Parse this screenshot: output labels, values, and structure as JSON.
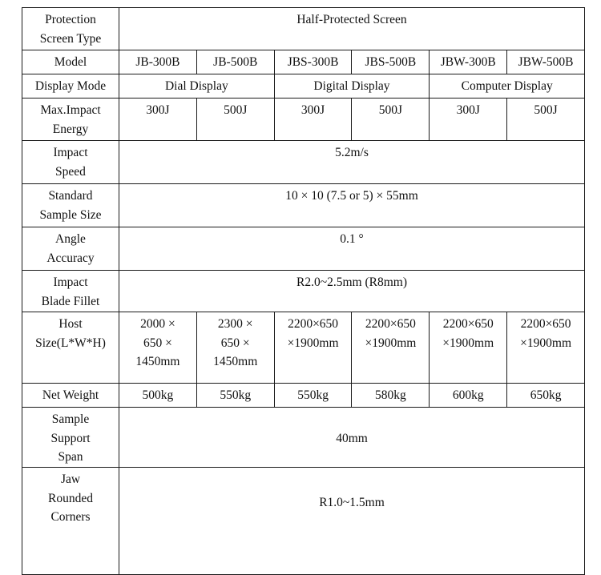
{
  "table": {
    "columns": [
      "JB-300B",
      "JB-500B",
      "JBS-300B",
      "JBS-500B",
      "JBW-300B",
      "JBW-500B"
    ],
    "rows": [
      {
        "label": "Protection\nScreen Type",
        "label_lines": [
          "Protection",
          "Screen Type"
        ],
        "span": true,
        "value": "Half-Protected Screen"
      },
      {
        "label": "Model",
        "label_lines": [
          "Model"
        ],
        "span": false,
        "values": [
          "JB-300B",
          "JB-500B",
          "JBS-300B",
          "JBS-500B",
          "JBW-300B",
          "JBW-500B"
        ]
      },
      {
        "label": "Display Mode",
        "label_lines": [
          "Display Mode"
        ],
        "span": false,
        "groups": [
          {
            "value": "Dial Display",
            "cols": 2
          },
          {
            "value": "Digital Display",
            "cols": 2
          },
          {
            "value": "Computer Display",
            "cols": 2
          }
        ]
      },
      {
        "label": "Max.Impact Energy",
        "label_lines": [
          "Max.Impact",
          "Energy"
        ],
        "span": false,
        "values": [
          "300J",
          "500J",
          "300J",
          "500J",
          "300J",
          "500J"
        ]
      },
      {
        "label": "Impact Speed",
        "label_lines": [
          "Impact",
          "Speed"
        ],
        "span": true,
        "value": "5.2m/s"
      },
      {
        "label": "Standard Sample Size",
        "label_lines": [
          "Standard",
          "Sample Size"
        ],
        "span": true,
        "value": "10 × 10 (7.5 or 5) × 55mm"
      },
      {
        "label": "Angle Accuracy",
        "label_lines": [
          "Angle",
          "Accuracy"
        ],
        "span": true,
        "value": "0.1 °"
      },
      {
        "label": "Impact Blade Fillet",
        "label_lines": [
          "Impact",
          "Blade Fillet"
        ],
        "span": true,
        "value": "R2.0~2.5mm (R8mm)"
      },
      {
        "label": "Host Size(L*W*H)",
        "label_lines": [
          "Host",
          "Size(L*W*H)"
        ],
        "span": false,
        "values_lines": [
          [
            "2000 ×",
            "650 ×",
            "1450mm"
          ],
          [
            "2300 ×",
            "650 ×",
            "1450mm"
          ],
          [
            "2200×650",
            "×1900mm"
          ],
          [
            "2200×650",
            "×1900mm"
          ],
          [
            "2200×650",
            "×1900mm"
          ],
          [
            "2200×650",
            "×1900mm"
          ]
        ]
      },
      {
        "label": "Net Weight",
        "label_lines": [
          "Net Weight"
        ],
        "span": false,
        "values": [
          "500kg",
          "550kg",
          "550kg",
          "580kg",
          "600kg",
          "650kg"
        ]
      },
      {
        "label": "Sample Support Span",
        "label_lines": [
          "Sample",
          "Support",
          "Span"
        ],
        "span": true,
        "value": "40mm"
      },
      {
        "label": "Jaw Rounded Corners",
        "label_lines": [
          "Jaw",
          "Rounded",
          "Corners"
        ],
        "span": true,
        "value": "R1.0~1.5mm"
      }
    ]
  },
  "colors": {
    "border": "#1a1a1a",
    "text": "#111111",
    "background": "#ffffff"
  }
}
